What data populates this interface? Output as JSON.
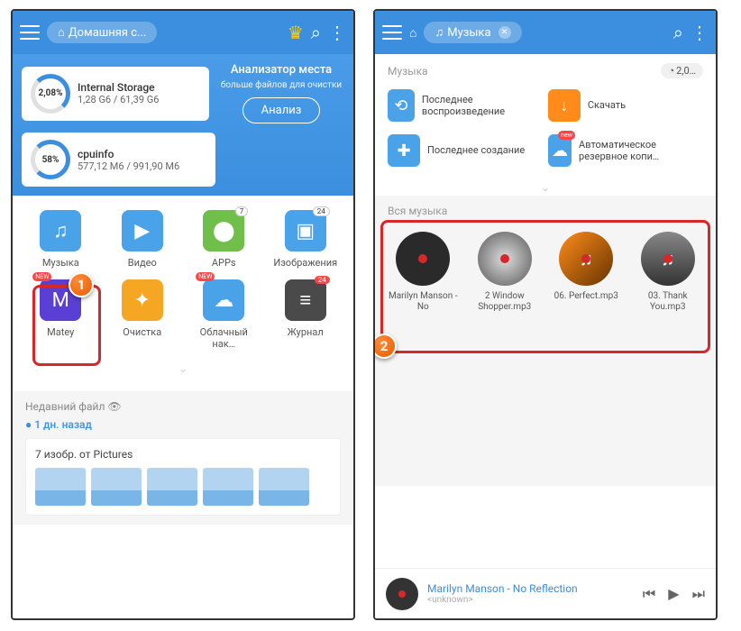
{
  "phone1": {
    "breadcrumb": "Домашняя с...",
    "analyzer": {
      "title": "Анализатор места",
      "sub": "больше файлов для очистки",
      "btn": "Анализ"
    },
    "storage": {
      "pct": "2,08%",
      "name": "Internal Storage",
      "size": "1,28 G6 / 61,39 G6"
    },
    "cpu": {
      "pct": "58%",
      "name": "cpuinfo",
      "size": "577,12 М6 / 991,90 М6"
    },
    "cats": [
      {
        "label": "Музыка",
        "color": "#4aa3e8",
        "glyph": "♫"
      },
      {
        "label": "Видео",
        "color": "#4aa3e8",
        "glyph": "▶"
      },
      {
        "label": "APPs",
        "color": "#6fbf4a",
        "glyph": "⬤",
        "badge": "7"
      },
      {
        "label": "Изображения",
        "color": "#4aa3e8",
        "glyph": "▣",
        "badge": "24"
      },
      {
        "label": "Matey",
        "color": "#5a3fd4",
        "glyph": "M",
        "newBadge": "NEW"
      },
      {
        "label": "Очистка",
        "color": "#f5a623",
        "glyph": "✦"
      },
      {
        "label": "Облачный нак…",
        "color": "#4aa3e8",
        "glyph": "☁",
        "newBadge": "NEW"
      },
      {
        "label": "Журнал",
        "color": "#4a4a4a",
        "glyph": "≡",
        "redbadge": "24"
      }
    ],
    "recent": {
      "title": "Недавний файл",
      "day": "1 дн. назад",
      "card": "7 изобр. от Pictures"
    }
  },
  "phone2": {
    "breadcrumb": "Музыка",
    "section": "Музыка",
    "pill": "2,0…",
    "quick": [
      {
        "label": "Последнее воспроизведение",
        "color": "#4aa3e8",
        "glyph": "⟲"
      },
      {
        "label": "Скачать",
        "color": "#ff8c1a",
        "glyph": "↓"
      },
      {
        "label": "Последнее создание",
        "color": "#4aa3e8",
        "glyph": "✚"
      },
      {
        "label": "Автоматическое резервное копи…",
        "color": "#4aa3e8",
        "glyph": "☁",
        "newBadge": "new"
      }
    ],
    "allmusic": "Вся музыка",
    "tracks": [
      {
        "name": "Marilyn Manson - No"
      },
      {
        "name": "2 Window Shopper.mp3"
      },
      {
        "name": "06. Perfect.mp3"
      },
      {
        "name": "03. Thank You.mp3"
      }
    ],
    "player": {
      "title": "Marilyn Manson - No Reflection",
      "artist": "<unknown>"
    }
  }
}
